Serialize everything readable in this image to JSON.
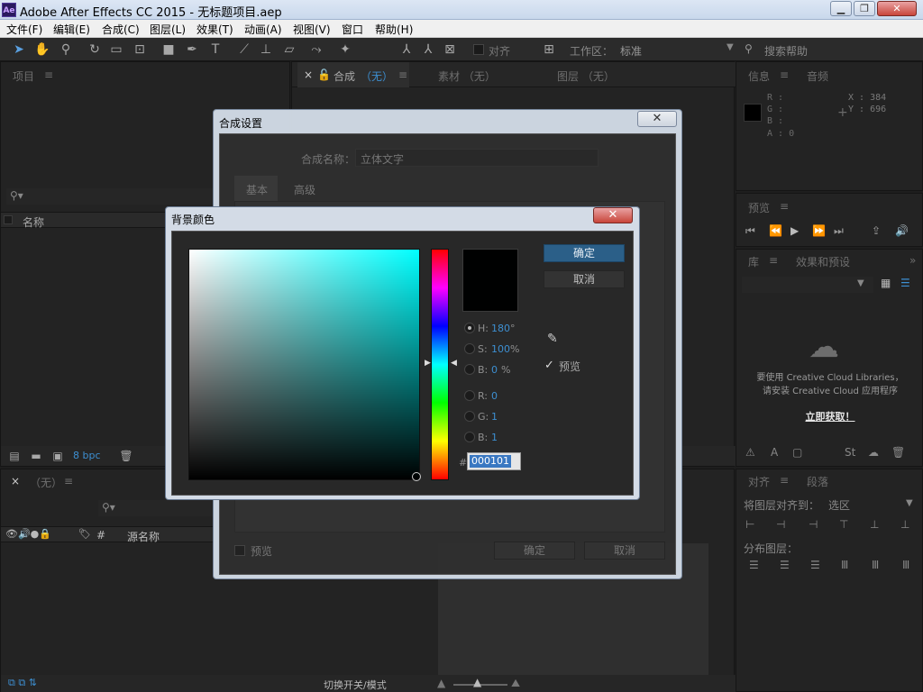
{
  "app": {
    "title": "Adobe After Effects CC 2015 - 无标题项目.aep",
    "logo": "Ae"
  },
  "window_buttons": [
    "minimize-icon",
    "restore-icon",
    "close-icon"
  ],
  "menu": [
    "文件(F)",
    "编辑(E)",
    "合成(C)",
    "图层(L)",
    "效果(T)",
    "动画(A)",
    "视图(V)",
    "窗口",
    "帮助(H)"
  ],
  "toolbar": {
    "align_label": "对齐",
    "workspace_label": "工作区：",
    "workspace_value": "标准",
    "search_placeholder": "搜索帮助"
  },
  "project_panel": {
    "title": "项目",
    "col_name": "名称",
    "bpc": "8 bpc"
  },
  "comp_panel": {
    "tab_comp": "合成",
    "tab_comp_value": "（无）",
    "tab_footage": "素材 （无）",
    "tab_layer": "图层 （无）"
  },
  "timeline_panel": {
    "title": "（无）",
    "col_source": "源名称",
    "hash": "#",
    "switch_label": "切换开关/模式"
  },
  "info_panel": {
    "tab_info": "信息",
    "tab_audio": "音频",
    "r": "R :",
    "g": "G :",
    "b": "B :",
    "a": "A : 0",
    "x": "X : 384",
    "y": "Y : 696"
  },
  "preview_panel": {
    "title": "预览"
  },
  "library_panel": {
    "tab_lib": "库",
    "tab_effects": "效果和预设",
    "msg1": "要使用 Creative Cloud Libraries，",
    "msg2": "请安装 Creative Cloud 应用程序",
    "link": "立即获取！"
  },
  "align_panel": {
    "tab_align": "对齐",
    "tab_para": "段落",
    "align_to_label": "将图层对齐到：",
    "align_to_value": "选区",
    "distribute_label": "分布图层："
  },
  "comp_dialog": {
    "title": "合成设置",
    "name_label": "合成名称：",
    "name_value": "立体文字",
    "tab_basic": "基本",
    "tab_advanced": "高级",
    "preview_label": "预览",
    "ok": "确定",
    "cancel": "取消"
  },
  "color_dialog": {
    "title": "背景颜色",
    "ok": "确定",
    "cancel": "取消",
    "h_label": "H:",
    "h_value": "180",
    "h_unit": "°",
    "s_label": "S:",
    "s_value": "100",
    "s_unit": "%",
    "b_label": "B:",
    "b_value": "0",
    "b_unit": "%",
    "r_label": "R:",
    "r_value": "0",
    "g_label": "G:",
    "g_value": "1",
    "b2_label": "B:",
    "b2_value": "1",
    "hex_label": "#",
    "hex_value": "000101",
    "preview_label": "预览",
    "preview_checked": true,
    "selected_hue_color": "#00ffff",
    "current_color": "#000101"
  }
}
